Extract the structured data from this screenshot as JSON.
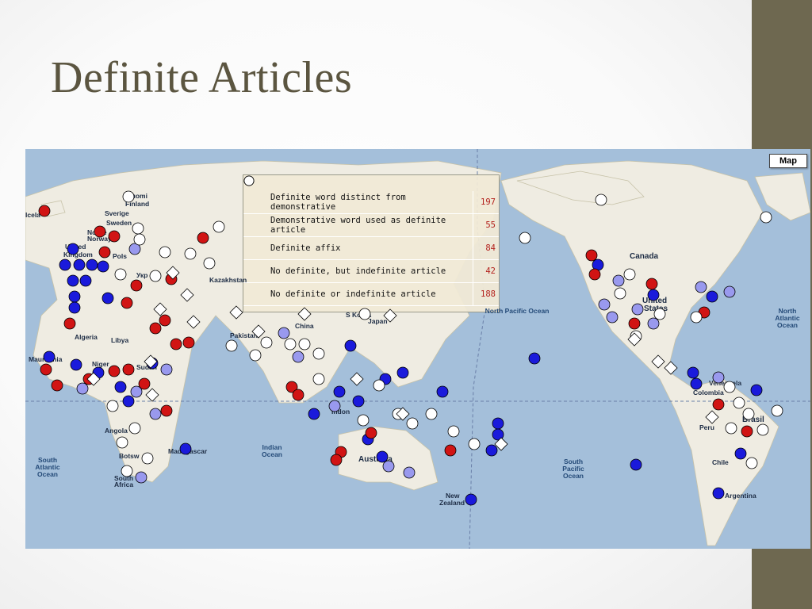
{
  "slide": {
    "title": "Definite Articles"
  },
  "map": {
    "button_label": "Map",
    "colors": {
      "ocean": "#a4bfda",
      "land": "#efece2",
      "blue": "#1a1adb",
      "light_blue": "#9999ee",
      "red": "#d11414",
      "white": "#ffffff"
    },
    "legend": [
      {
        "icon": "blue-dot",
        "label": "Definite word distinct from demonstrative",
        "count": "197"
      },
      {
        "icon": "light-blue-dot",
        "label": "Demonstrative word used as definite article",
        "count": "55"
      },
      {
        "icon": "red-dot",
        "label": "Definite affix",
        "count": "84"
      },
      {
        "icon": "white-diamond",
        "label": "No definite, but indefinite article",
        "count": "42"
      },
      {
        "icon": "white-dot",
        "label": "No definite or indefinite article",
        "count": "188"
      }
    ],
    "places": {
      "suomi": "Suomi",
      "finland": "Finland",
      "sverige": "Sverige",
      "sweden": "Sweden",
      "norge": "Norge",
      "norway": "Norway",
      "united": "United",
      "kingdom": "Kingdom",
      "pols": "Pols",
      "ukr": "Укр",
      "kazakhstan": "Kazakhstan",
      "algeria": "Algeria",
      "libya": "Libya",
      "mauritania": "Mauritania",
      "niger": "Niger",
      "sudan": "Sudan",
      "angola": "Angola",
      "madagascar": "Madagascar",
      "south_africa_1": "South",
      "south_africa_2": "Africa",
      "botswana": "Botsw",
      "china": "China",
      "pakistan": "Pakistan",
      "japan": "Japan",
      "korea": "S Korea",
      "australia": "Australia",
      "new_zealand_1": "New",
      "new_zealand_2": "Zealand",
      "indonesia": "Indon",
      "canada": "Canada",
      "united_states_1": "United",
      "united_states_2": "States",
      "venezuela": "Venezuela",
      "colombia": "Colombia",
      "brasil": "Brasil",
      "chile": "Chile",
      "argentina": "Argentina",
      "iceland": "Icela",
      "peru": "Peru"
    },
    "oceans": {
      "north_pacific": "North Pacific Ocean",
      "south_pacific": "South Pacific Ocean",
      "north_atlantic": "North Atlantic Ocean",
      "south_atlantic": "South Atlantic Ocean",
      "indian": "Indian Ocean"
    }
  }
}
